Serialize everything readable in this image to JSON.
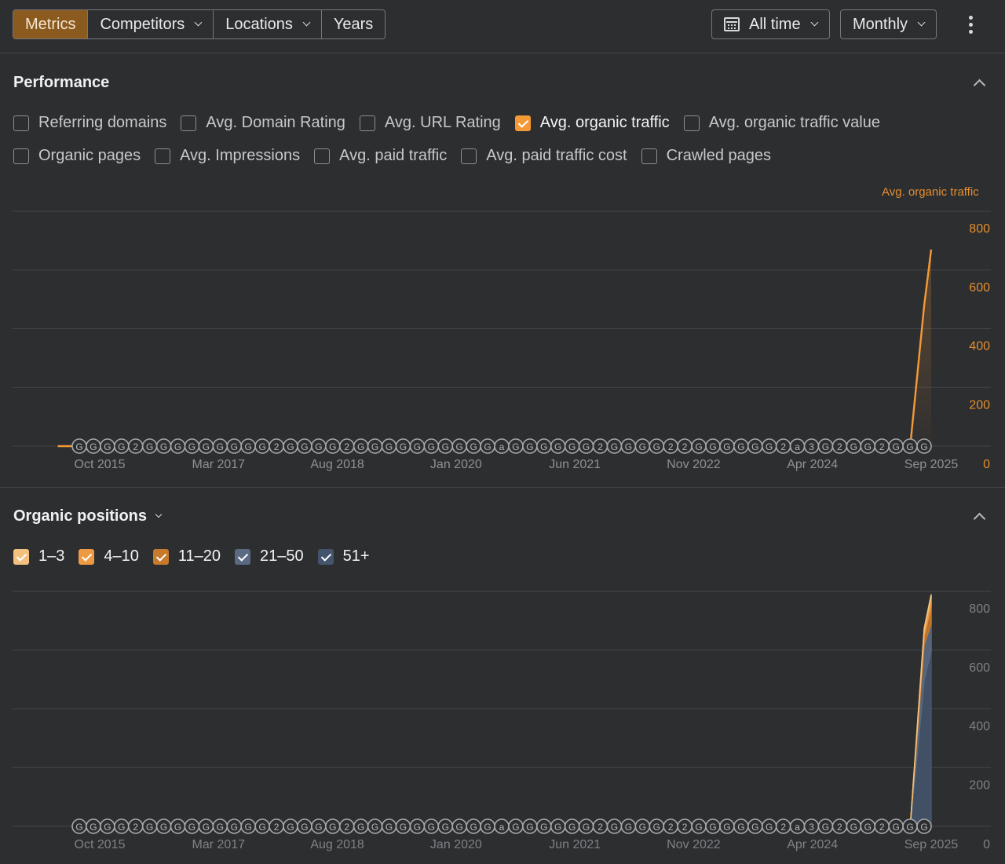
{
  "toolbar": {
    "tabs": [
      {
        "label": "Metrics"
      },
      {
        "label": "Competitors"
      },
      {
        "label": "Locations"
      },
      {
        "label": "Years"
      }
    ],
    "date_range": {
      "label": "All time",
      "icon": "calendar-icon"
    },
    "interval": {
      "label": "Monthly"
    },
    "more_icon": "kebab-icon"
  },
  "performance": {
    "title": "Performance",
    "metrics_row1": [
      {
        "label": "Referring domains",
        "checked": false
      },
      {
        "label": "Avg. Domain Rating",
        "checked": false
      },
      {
        "label": "Avg. URL Rating",
        "checked": false
      },
      {
        "label": "Avg. organic traffic",
        "checked": true,
        "color": "#f39a37"
      },
      {
        "label": "Avg. organic traffic value",
        "checked": false
      }
    ],
    "metrics_row2": [
      {
        "label": "Organic pages",
        "checked": false
      },
      {
        "label": "Avg. Impressions",
        "checked": false
      },
      {
        "label": "Avg. paid traffic",
        "checked": false
      },
      {
        "label": "Avg. paid traffic cost",
        "checked": false
      },
      {
        "label": "Crawled pages",
        "checked": false
      }
    ]
  },
  "organic_positions": {
    "title": "Organic positions",
    "filters": [
      {
        "label": "1–3",
        "checked": true,
        "color": "#f2c17f"
      },
      {
        "label": "4–10",
        "checked": true,
        "color": "#ee9a42"
      },
      {
        "label": "11–20",
        "checked": true,
        "color": "#c67a2c"
      },
      {
        "label": "21–50",
        "checked": true,
        "color": "#5b6a82"
      },
      {
        "label": "51+",
        "checked": true,
        "color": "#44546c"
      }
    ]
  },
  "chart_data": [
    {
      "type": "line",
      "title": "",
      "ylabel": "Avg. organic traffic",
      "ylim": [
        0,
        800
      ],
      "yticks": [
        "0",
        "200",
        "400",
        "600",
        "800"
      ],
      "xtick_labels": [
        "Oct 2015",
        "Mar 2017",
        "Aug 2018",
        "Jan 2020",
        "Jun 2021",
        "Nov 2022",
        "Apr 2024",
        "Sep 2025"
      ],
      "grid": true,
      "series": [
        {
          "color": "#f39a37",
          "x": [
            "2015-04",
            "2025-06",
            "2025-08",
            "2025-09"
          ],
          "y": [
            0,
            0,
            480,
            670
          ]
        }
      ],
      "annotation_markers": [
        "G",
        "G",
        "G",
        "G",
        "2",
        "G",
        "G",
        "G",
        "G",
        "G",
        "G",
        "G",
        "G",
        "G",
        "2",
        "G",
        "G",
        "G",
        "G",
        "2",
        "G",
        "G",
        "G",
        "G",
        "G",
        "G",
        "G",
        "G",
        "G",
        "G",
        "a",
        "G",
        "G",
        "G",
        "G",
        "G",
        "G",
        "2",
        "G",
        "G",
        "G",
        "G",
        "2",
        "2",
        "G",
        "G",
        "G",
        "G",
        "G",
        "G",
        "2",
        "a",
        "3",
        "G",
        "2",
        "G",
        "G",
        "2",
        "G",
        "G",
        "G"
      ]
    },
    {
      "type": "area",
      "title": "",
      "ylim": [
        0,
        800
      ],
      "yticks": [
        "0",
        "200",
        "400",
        "600",
        "800"
      ],
      "xtick_labels": [
        "Oct 2015",
        "Mar 2017",
        "Aug 2018",
        "Jan 2020",
        "Jun 2021",
        "Nov 2022",
        "Apr 2024",
        "Sep 2025"
      ],
      "grid": true,
      "series": [
        {
          "name": "51+",
          "color": "#44546c",
          "x": [
            "2025-06",
            "2025-08",
            "2025-09"
          ],
          "y": [
            0,
            500,
            600
          ]
        },
        {
          "name": "21–50",
          "color": "#5b6a82",
          "x": [
            "2025-06",
            "2025-08",
            "2025-09"
          ],
          "y": [
            0,
            120,
            90
          ]
        },
        {
          "name": "11–20",
          "color": "#c67a2c",
          "x": [
            "2025-06",
            "2025-08",
            "2025-09"
          ],
          "y": [
            0,
            30,
            60
          ]
        },
        {
          "name": "4–10",
          "color": "#ee9a42",
          "x": [
            "2025-06",
            "2025-08",
            "2025-09"
          ],
          "y": [
            0,
            20,
            30
          ]
        },
        {
          "name": "1–3",
          "color": "#f2c17f",
          "x": [
            "2025-06",
            "2025-08",
            "2025-09"
          ],
          "y": [
            0,
            5,
            10
          ]
        }
      ],
      "annotation_markers": [
        "G",
        "G",
        "G",
        "G",
        "2",
        "G",
        "G",
        "G",
        "G",
        "G",
        "G",
        "G",
        "G",
        "G",
        "2",
        "G",
        "G",
        "G",
        "G",
        "2",
        "G",
        "G",
        "G",
        "G",
        "G",
        "G",
        "G",
        "G",
        "G",
        "G",
        "a",
        "G",
        "G",
        "G",
        "G",
        "G",
        "G",
        "2",
        "G",
        "G",
        "G",
        "G",
        "2",
        "2",
        "G",
        "G",
        "G",
        "G",
        "G",
        "G",
        "2",
        "a",
        "3",
        "G",
        "2",
        "G",
        "G",
        "2",
        "G",
        "G",
        "G"
      ]
    }
  ]
}
